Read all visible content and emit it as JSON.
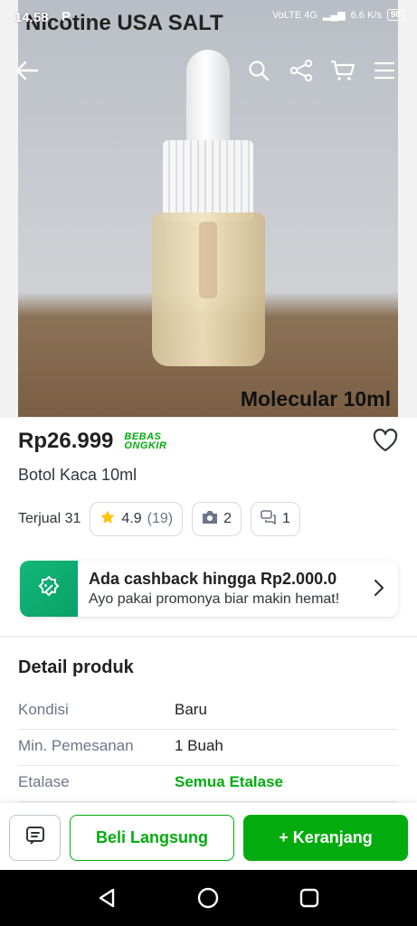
{
  "status_bar": {
    "time": "14.58",
    "notification_letter": "P",
    "network": "VoLTE 4G",
    "speed": "6.6 K/s",
    "battery": "98"
  },
  "photo": {
    "top_text": "Nicotine USA SALT",
    "bottom_text": "Molecular 10ml"
  },
  "product": {
    "price": "Rp26.999",
    "shipping_badge_line1": "BEBAS",
    "shipping_badge_line2": "ONGKIR",
    "name": "Botol Kaca 10ml",
    "sold": "Terjual 31",
    "rating": "4.9",
    "rating_count": "(19)",
    "photo_reviews": "2",
    "discussions": "1"
  },
  "cashback": {
    "title": "Ada cashback hingga Rp2.000.0",
    "subtitle": "Ayo pakai promonya biar makin hemat!"
  },
  "detail": {
    "title": "Detail produk",
    "rows": [
      {
        "label": "Kondisi",
        "value": "Baru"
      },
      {
        "label": "Min. Pemesanan",
        "value": "1 Buah"
      },
      {
        "label": "Etalase",
        "value": "Semua Etalase"
      }
    ]
  },
  "actions": {
    "buy_now": "Beli Langsung",
    "add_to_cart": "+ Keranjang"
  },
  "colors": {
    "accent": "#03ac0e",
    "text": "#212121"
  }
}
